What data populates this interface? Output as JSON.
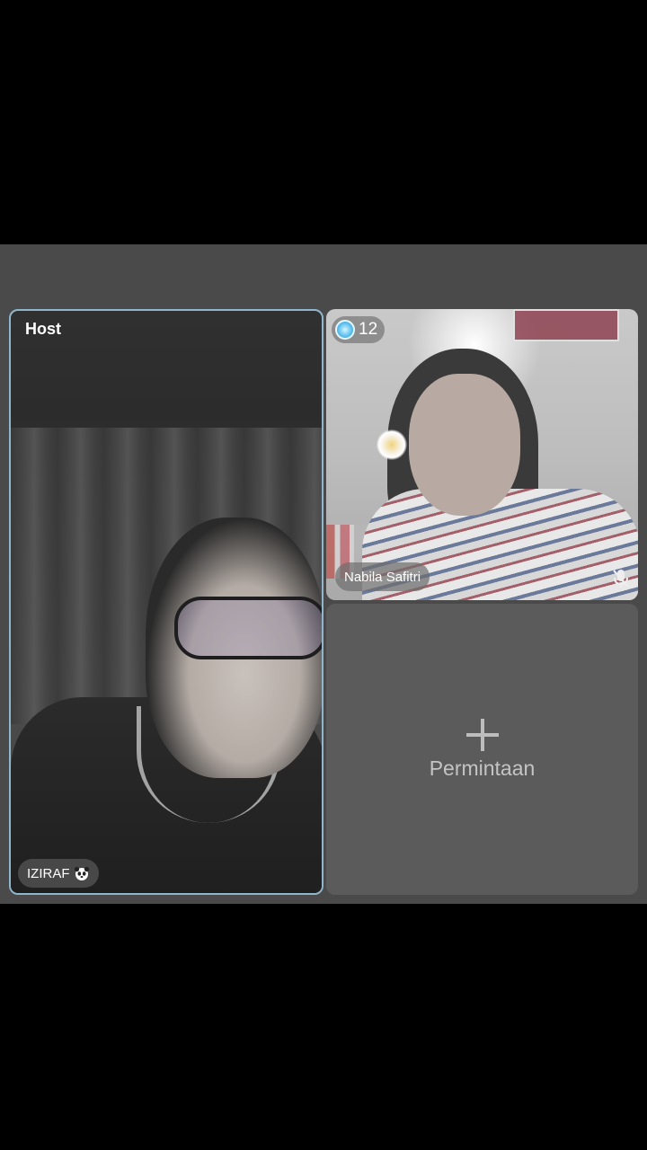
{
  "host_tile": {
    "label": "Host",
    "name": "IZIRAF",
    "name_icon": "panda-icon"
  },
  "guest_tile": {
    "viewer_count": "12",
    "viewer_icon": "gem-icon",
    "name": "Nabila Safitri",
    "mic_status_icon": "mic-muted-icon"
  },
  "request_tile": {
    "label": "Permintaan",
    "icon": "plus-icon"
  },
  "colors": {
    "stage_bg": "#4a4a4a",
    "host_border": "#8fb6cc",
    "request_bg": "#5b5b5b"
  }
}
